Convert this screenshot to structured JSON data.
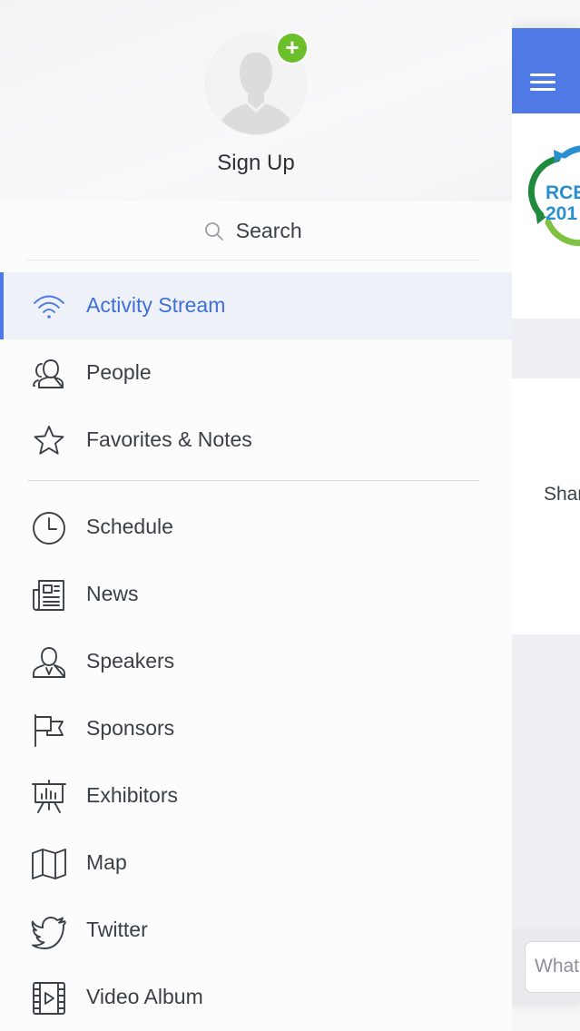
{
  "drawer": {
    "sign_up": "Sign Up",
    "search_label": "Search",
    "items": [
      {
        "label": "Activity Stream",
        "icon": "wifi-icon",
        "active": true
      },
      {
        "label": "People",
        "icon": "people-icon"
      },
      {
        "label": "Favorites & Notes",
        "icon": "star-icon"
      },
      {
        "label": "Schedule",
        "icon": "clock-icon"
      },
      {
        "label": "News",
        "icon": "newspaper-icon"
      },
      {
        "label": "Speakers",
        "icon": "speakers-icon"
      },
      {
        "label": "Sponsors",
        "icon": "flag-icon"
      },
      {
        "label": "Exhibitors",
        "icon": "presentation-board-icon"
      },
      {
        "label": "Map",
        "icon": "map-icon"
      },
      {
        "label": "Twitter",
        "icon": "twitter-bird-icon"
      },
      {
        "label": "Video Album",
        "icon": "film-icon"
      }
    ]
  },
  "app": {
    "logo_text_line1": "RCE",
    "logo_text_line2": "201",
    "share_text": "Shar",
    "compose_placeholder": "What"
  },
  "colors": {
    "accent": "#4f7ae6",
    "active_bg": "#eff1f8",
    "plus_badge": "#6bbf2a",
    "logo_green": "#1f8a3c",
    "logo_blue": "#2a8fd0"
  }
}
